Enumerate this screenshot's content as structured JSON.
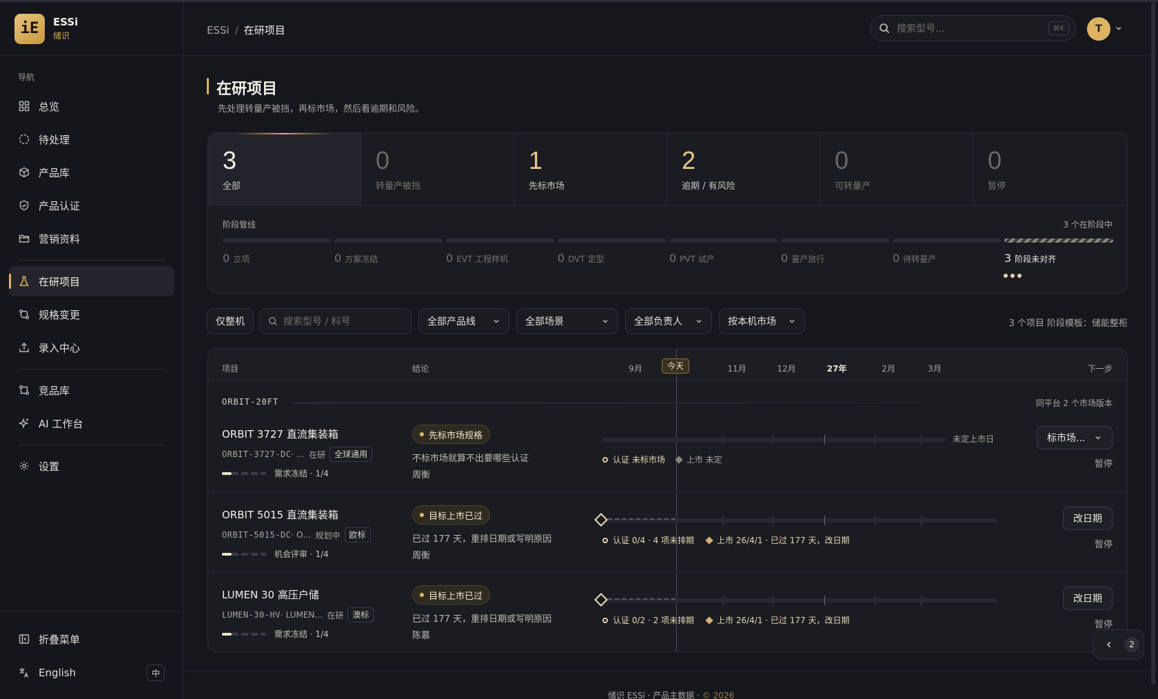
{
  "app": {
    "name": "ESSi",
    "sub": "储识",
    "logo_glyph": "iE"
  },
  "topbar": {
    "breadcrumb_root": "ESSi",
    "breadcrumb_sep": "/",
    "breadcrumb_current": "在研项目",
    "search_placeholder": "搜索型号...",
    "search_kbd": "⌘K",
    "avatar_initial": "T"
  },
  "sidebar": {
    "section_label": "导航",
    "items": [
      {
        "label": "总览"
      },
      {
        "label": "待处理"
      },
      {
        "label": "产品库"
      },
      {
        "label": "产品认证"
      },
      {
        "label": "营销资料"
      },
      {
        "label": "在研项目"
      },
      {
        "label": "规格变更"
      },
      {
        "label": "录入中心"
      },
      {
        "label": "竞品库"
      },
      {
        "label": "AI 工作台"
      },
      {
        "label": "设置"
      }
    ],
    "collapse_label": "折叠菜单",
    "language_label": "English",
    "language_toggle": "中"
  },
  "page": {
    "title": "在研项目",
    "subtitle": "先处理转量产被挡，再标市场，然后看逾期和风险。"
  },
  "stats": [
    {
      "value": "3",
      "label": "全部"
    },
    {
      "value": "0",
      "label": "转量产被挡"
    },
    {
      "value": "1",
      "label": "先标市场"
    },
    {
      "value": "2",
      "label": "逾期 / 有风险"
    },
    {
      "value": "0",
      "label": "可转量产"
    },
    {
      "value": "0",
      "label": "暂停"
    }
  ],
  "pipeline": {
    "title": "阶段管线",
    "summary": "3 个在阶段中",
    "stages": [
      {
        "count": "0",
        "label": "立项"
      },
      {
        "count": "0",
        "label": "方案冻结"
      },
      {
        "count": "0",
        "label": "EVT 工程样机"
      },
      {
        "count": "0",
        "label": "DVT 定型"
      },
      {
        "count": "0",
        "label": "PVT 试产"
      },
      {
        "count": "0",
        "label": "量产放行"
      },
      {
        "count": "0",
        "label": "待转量产"
      },
      {
        "count": "3",
        "label": "阶段未对齐"
      }
    ]
  },
  "filters": {
    "whole_unit": "仅整机",
    "search_placeholder": "搜索型号 / 料号",
    "product_line": "全部产品线",
    "scenario": "全部场景",
    "owner": "全部负责人",
    "market": "按本机市场",
    "summary": "3 个项目   阶段模板：储能整柜"
  },
  "table": {
    "headers": {
      "project": "项目",
      "conclusion": "结论",
      "next": "下一步"
    },
    "months": [
      "9月",
      "今天",
      "11月",
      "12月",
      "27年",
      "2月",
      "3月"
    ],
    "group": {
      "name": "ORBIT-20FT",
      "note": "同平台 2 个市场版本"
    },
    "rows": [
      {
        "name": "ORBIT 3727 直流集装箱",
        "code": "ORBIT-3727-DC",
        "code_extra": " · …",
        "status": "在研",
        "tag": "全球通用",
        "progress_label": "需求冻结 · 1/4",
        "progress": 0.25,
        "badge": "先标市场规格",
        "conclusion": "不标市场就算不出要哪些认证",
        "owner": "周衡",
        "tl_end": "未定上市日",
        "cert_text": "认证 未标市场",
        "launch_text": "上市 未定",
        "action": "标市场...",
        "sub_action": "暂停"
      },
      {
        "name": "ORBIT 5015 直流集装箱",
        "code": "ORBIT-5015-DC",
        "code_extra": " · O…",
        "status": "规划中",
        "tag": "欧标",
        "progress_label": "机会评审 · 1/4",
        "progress": 0.25,
        "badge": "目标上市已过",
        "conclusion": "已过 177 天，重排日期或写明原因",
        "owner": "周衡",
        "cert_text": "认证 0/4 · 4 项未排期",
        "launch_text": "上市 26/4/1 · 已过 177 天，改日期",
        "action": "改日期",
        "sub_action": "暂停"
      },
      {
        "name": "LUMEN 30 高压户储",
        "code": "LUMEN-30-HV",
        "code_extra": " · LUMEN…",
        "status": "在研",
        "tag": "澳标",
        "progress_label": "需求冻结 · 1/4",
        "progress": 0.25,
        "badge": "目标上市已过",
        "conclusion": "已过 177 天，重排日期或写明原因",
        "owner": "陈慕",
        "cert_text": "认证 0/2 · 2 项未排期",
        "launch_text": "上市 26/4/1 · 已过 177 天，改日期",
        "action": "改日期",
        "sub_action": "暂停"
      }
    ]
  },
  "pager": {
    "current": "2"
  },
  "footer": {
    "text": "储识 ESSi · 产品主数据 · ",
    "year": "© 2026"
  },
  "colors": {
    "accent": "#e0b560",
    "bg": "#16171d",
    "panel": "#1b1c22"
  }
}
